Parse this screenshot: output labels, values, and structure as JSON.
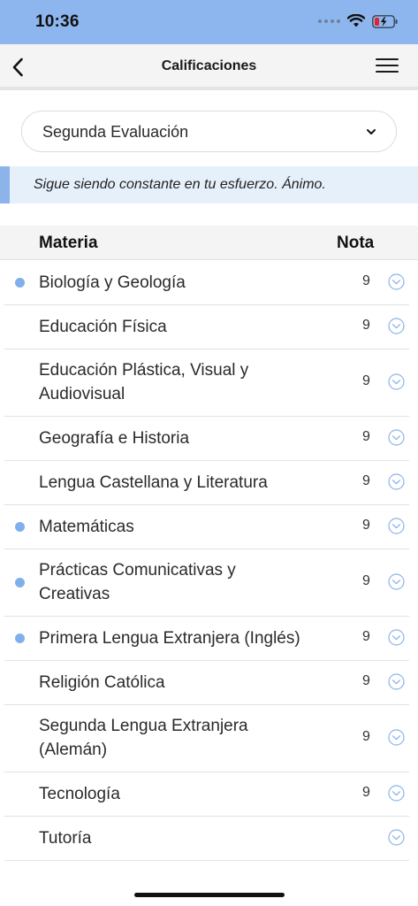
{
  "status_bar": {
    "time": "10:36",
    "color": "#8db6ee",
    "icons": [
      "signal-icon",
      "wifi-icon",
      "battery-charging-icon"
    ]
  },
  "nav": {
    "title": "Calificaciones",
    "back_icon": "chevron-left-icon",
    "menu_icon": "hamburger-menu-icon"
  },
  "evaluation_select": {
    "value": "Segunda Evaluación",
    "icon": "chevron-down-icon"
  },
  "banner": {
    "message": "Sigue siendo constante en tu esfuerzo. Ánimo.",
    "accent": "#8cb4ea"
  },
  "table": {
    "headers": {
      "subject": "Materia",
      "grade": "Nota"
    },
    "rows": [
      {
        "subject": "Biología y Geología",
        "grade": "9",
        "dot": true,
        "lines": 1
      },
      {
        "subject": "Educación Física",
        "grade": "9",
        "dot": false,
        "lines": 1
      },
      {
        "subject": "Educación Plástica, Visual y Audiovisual",
        "grade": "9",
        "dot": false,
        "lines": 2
      },
      {
        "subject": "Geografía e Historia",
        "grade": "9",
        "dot": false,
        "lines": 1
      },
      {
        "subject": "Lengua Castellana y Literatura",
        "grade": "9",
        "dot": false,
        "lines": 1
      },
      {
        "subject": "Matemáticas",
        "grade": "9",
        "dot": true,
        "lines": 1
      },
      {
        "subject": "Prácticas Comunicativas y Creativas",
        "grade": "9",
        "dot": true,
        "lines": 2
      },
      {
        "subject": "Primera Lengua Extranjera (Inglés)",
        "grade": "9",
        "dot": true,
        "lines": 1
      },
      {
        "subject": "Religión Católica",
        "grade": "9",
        "dot": false,
        "lines": 1
      },
      {
        "subject": "Segunda Lengua Extranjera (Alemán)",
        "grade": "9",
        "dot": false,
        "lines": 2
      },
      {
        "subject": "Tecnología",
        "grade": "9",
        "dot": false,
        "lines": 1
      },
      {
        "subject": "Tutoría",
        "grade": "",
        "dot": false,
        "lines": 1
      }
    ]
  },
  "colors": {
    "dot": "#7fb0ec",
    "toggle": "#8cb4ea"
  }
}
